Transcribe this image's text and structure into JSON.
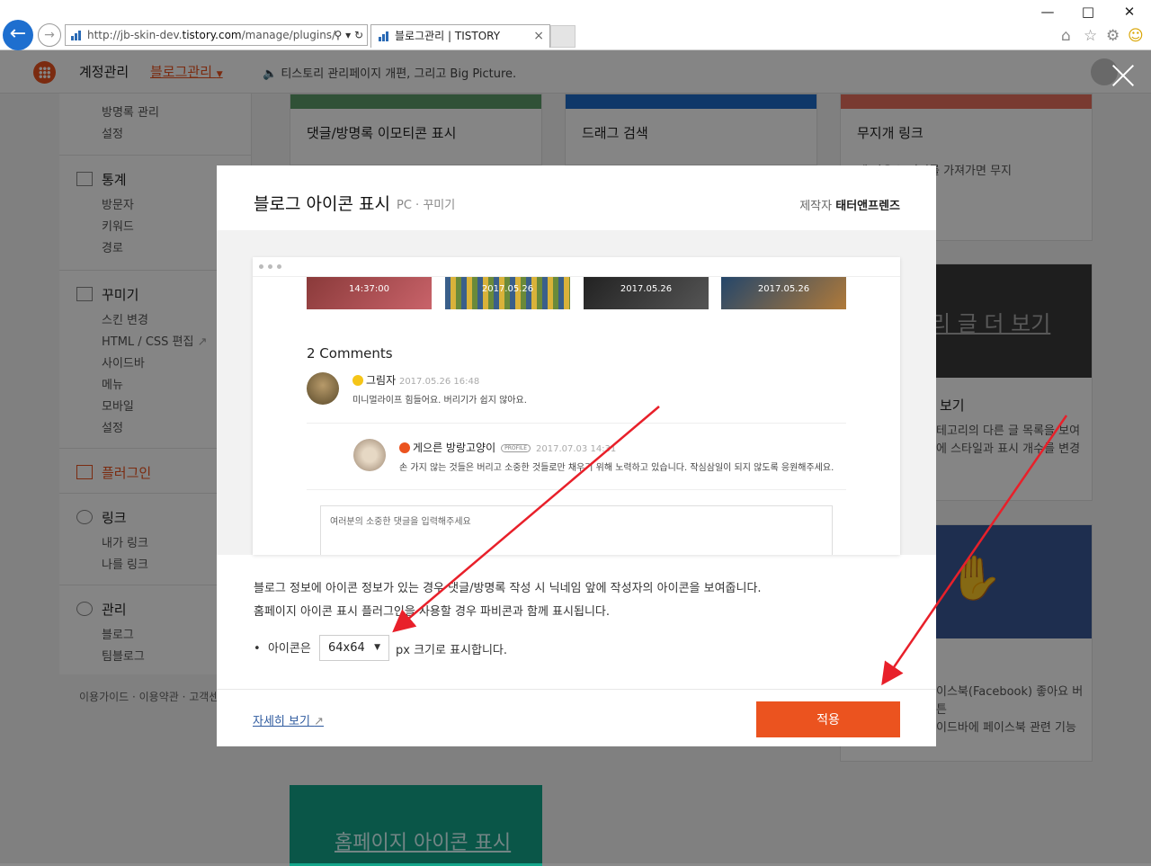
{
  "browser": {
    "url_prefix": "http://jb-skin-dev.",
    "url_domain": "tistory.com",
    "url_suffix": "/manage/plugins/",
    "tab_title": "블로그관리 | TISTORY"
  },
  "topbar": {
    "account": "계정관리",
    "blog_manage": "블로그관리",
    "notice": "티스토리 관리페이지 개편, 그리고 Big Picture."
  },
  "sidebar": {
    "top_items": [
      "방명록 관리",
      "설정"
    ],
    "stats": {
      "title": "통계",
      "items": [
        "방문자",
        "키워드",
        "경로"
      ]
    },
    "design": {
      "title": "꾸미기",
      "items": [
        "스킨 변경",
        "HTML / CSS 편집",
        "사이드바",
        "메뉴",
        "모바일",
        "설정"
      ]
    },
    "plugin": {
      "title": "플러그인"
    },
    "link": {
      "title": "링크",
      "items": [
        "내가 링크",
        "나를 링크"
      ]
    },
    "manage": {
      "title": "관리",
      "items": [
        "블로그",
        "팀블로그"
      ]
    },
    "footer": "이용가이드 · 이용약관 · 고객센"
  },
  "cards": {
    "c1": "댓글/방명록 이모티콘 표시",
    "c2": "드래그 검색",
    "c3": "무지개 링크",
    "c3_desc": "에 마우스 커서를 가져가면 무지",
    "c6_big": "리 글 더 보기",
    "c6_title": "보기",
    "c6_desc1": "테고리의 다른 글 목록을 보여",
    "c6_desc2": "에 스타일과 표시 개수를 변경",
    "c9_desc1": "이스북(Facebook) 좋아요 버튼",
    "c9_desc2": "이드바에 페이스북 관련 기능",
    "c10_big": "홈페이지 아이콘 표시"
  },
  "modal": {
    "title": "블로그 아이콘 표시",
    "platform": "PC",
    "category": "꾸미기",
    "maker_label": "제작자",
    "maker": "태터앤프렌즈",
    "preview": {
      "thumbs": [
        "14:37:00",
        "2017.05.26",
        "2017.05.26",
        "2017.05.26"
      ],
      "comments_count": "2 Comments",
      "c1_name": "그림자",
      "c1_date": "2017.05.26 16:48",
      "c1_text": "미니멀라이프 힘들어요. 버리기가 쉽지 않아요.",
      "c2_name": "게으른 방랑고양이",
      "c2_badge": "PROFILE",
      "c2_date": "2017.07.03 14:31",
      "c2_text": "손 가지 않는 것들은 버리고 소중한 것들로만 채우기 위해 노력하고 있습니다. 작심삼일이 되지 않도록 응원해주세요.",
      "input_placeholder": "여러분의 소중한 댓글을 입력해주세요"
    },
    "desc_line1": "블로그 정보에 아이콘 정보가 있는 경우 댓글/방명록 작성 시 닉네임 앞에 작성자의 아이콘을 보여줍니다.",
    "desc_line2": "홈페이지 아이콘 표시 플러그인을 사용할 경우 파비콘과 함께 표시됩니다.",
    "option_prefix": "아이콘은",
    "option_value": "64x64",
    "option_suffix": "px 크기로 표시합니다.",
    "more_link": "자세히 보기",
    "apply_button": "적용"
  },
  "colors": {
    "accent": "#eb531f",
    "link": "#2e5a9f",
    "annotation": "#e8202a"
  }
}
